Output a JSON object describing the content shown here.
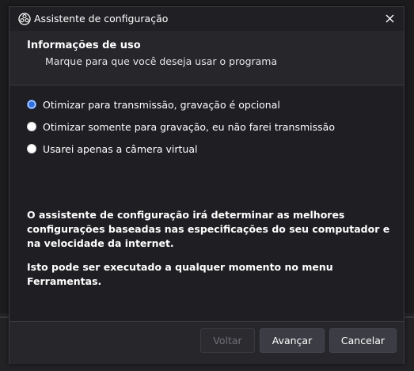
{
  "window": {
    "title": "Assistente de configuração",
    "app_icon": "obs-icon",
    "close_icon": "close-icon"
  },
  "header": {
    "title": "Informações de uso",
    "subtitle": "Marque para que você deseja usar o programa"
  },
  "options": [
    {
      "label": "Otimizar para transmissão, gravação é opcional",
      "checked": true
    },
    {
      "label": "Otimizar somente para gravação, eu não farei transmissão",
      "checked": false
    },
    {
      "label": "Usarei apenas a câmera virtual",
      "checked": false
    }
  ],
  "info": {
    "paragraph1": "O assistente de configuração irá determinar as melhores configurações baseadas nas especificações do seu computador e na velocidade da internet.",
    "paragraph2": "Isto pode ser executado a qualquer momento no menu Ferramentas."
  },
  "footer": {
    "back_label": "Voltar",
    "next_label": "Avançar",
    "cancel_label": "Cancelar"
  },
  "colors": {
    "accent": "#2f6fe0",
    "dialog_bg": "#1f1f23",
    "header_bg": "#26262b",
    "button_bg": "#3c3c44"
  }
}
